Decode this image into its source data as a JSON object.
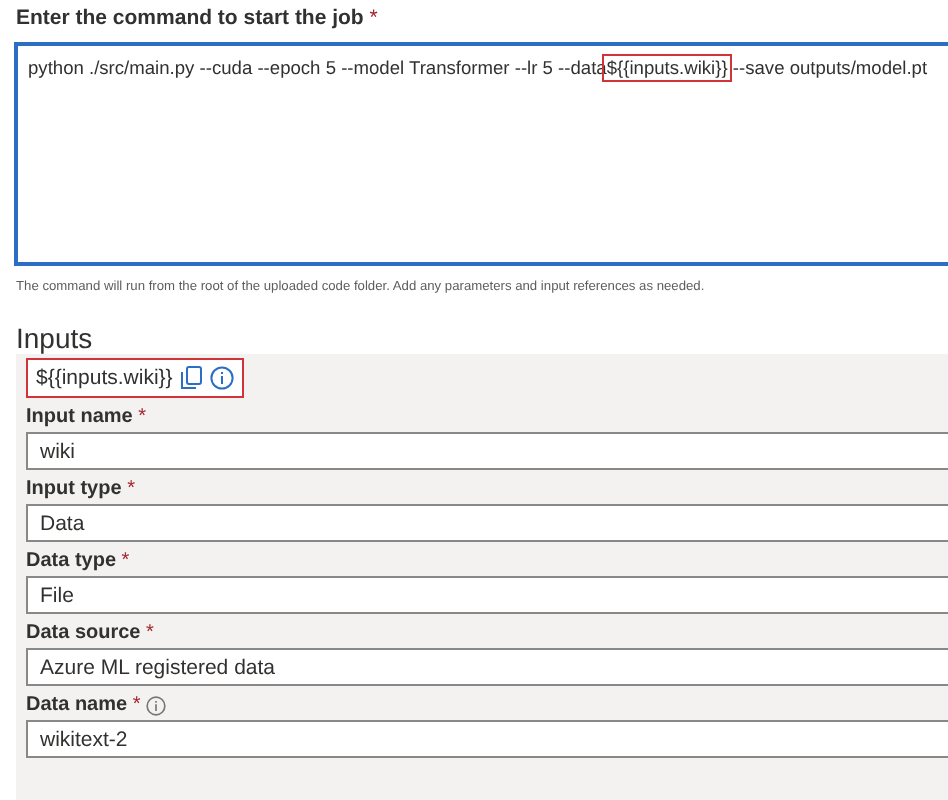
{
  "command": {
    "label": "Enter the command to start the job",
    "mark": "*",
    "before": "python ./src/main.py --cuda --epoch 5 --model Transformer --lr 5 --data",
    "highlight": "${{inputs.wiki}}",
    "after": " --save outputs/model.pt",
    "hint": "The command will run from the root of the uploaded code folder. Add any parameters and input references as needed."
  },
  "inputs": {
    "title": "Inputs",
    "reference": "${{inputs.wiki}}",
    "fields": [
      {
        "label": "Input name",
        "mark": "*",
        "info": false,
        "value": "wiki"
      },
      {
        "label": "Input type",
        "mark": "*",
        "info": false,
        "value": "Data"
      },
      {
        "label": "Data type",
        "mark": "*",
        "info": false,
        "value": "File"
      },
      {
        "label": "Data source",
        "mark": "*",
        "info": false,
        "value": "Azure ML registered data"
      },
      {
        "label": "Data name",
        "mark": "*",
        "info": true,
        "value": "wikitext-2"
      }
    ]
  }
}
